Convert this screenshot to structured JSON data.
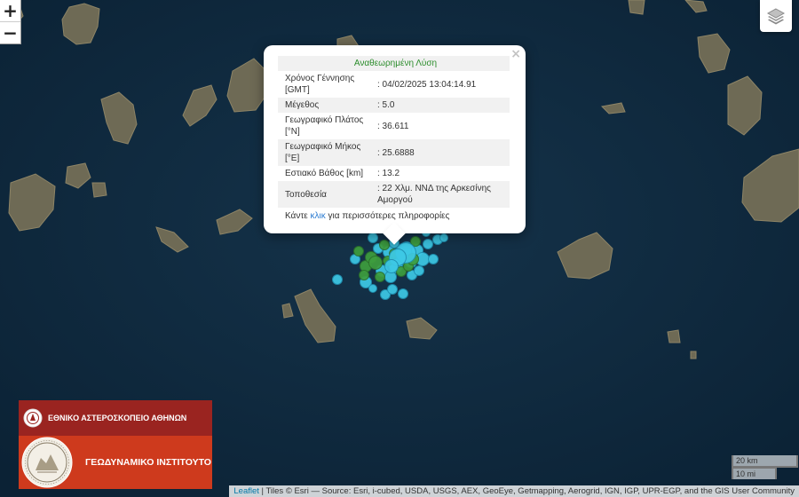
{
  "zoom": {
    "in_label": "+",
    "out_label": "−"
  },
  "popup": {
    "close_label": "×",
    "title": "Αναθεωρημένη Λύση",
    "rows": [
      {
        "label": "Χρόνος Γέννησης [GMT]",
        "value": ": 04/02/2025 13:04:14.91"
      },
      {
        "label": "Μέγεθος",
        "value": ": 5.0"
      },
      {
        "label": "Γεωγραφικό Πλάτος [°N]",
        "value": ": 36.611"
      },
      {
        "label": "Γεωγραφικό Μήκος [°E]",
        "value": ": 25.6888"
      },
      {
        "label": "Εστιακό Βάθος [km]",
        "value": ": 13.2"
      },
      {
        "label": "Τοποθεσία",
        "value": ": 22 Χλμ. ΝΝΔ της Αρκεσίνης Αμοργού"
      }
    ],
    "more_prefix": "Κάντε",
    "more_link": "κλικ",
    "more_suffix": "για περισσότερες πληροφορίες"
  },
  "logo": {
    "top_text": "ΕΘΝΙΚΟ ΑΣΤΕΡΟΣΚΟΠΕΙΟ ΑΘΗΝΩΝ",
    "bottom_text": "ΓΕΩΔΥΝΑΜΙΚΟ ΙΝΣΤΙΤΟΥΤΟ"
  },
  "scale": {
    "metric": "20 km",
    "imperial": "10 mi"
  },
  "attribution": {
    "link": "Leaflet",
    "text": " | Tiles © Esri — Source: Esri, i-cubed, USDA, USGS, AEX, GeoEye, Getmapping, Aerogrid, IGN, IGP, UPR-EGP, and the GIS User Community"
  },
  "colors": {
    "sea": "#0f2a3e",
    "recent_quake": "#3ec9e6",
    "older_quake": "#3e9e3e",
    "popup_title": "#2c8d2c",
    "link": "#2a7bd1"
  },
  "icons": {
    "layers": "layers-icon",
    "zoom_in": "plus-icon",
    "zoom_out": "minus-icon"
  }
}
